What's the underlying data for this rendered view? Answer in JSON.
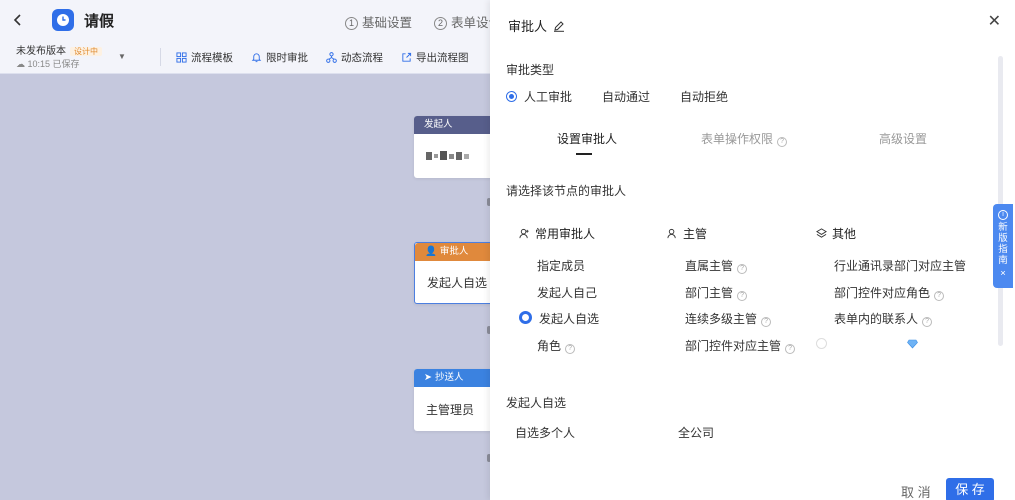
{
  "header": {
    "app_title": "请假",
    "steps": [
      {
        "num": "1",
        "label": "基础设置"
      },
      {
        "num": "2",
        "label": "表单设计"
      }
    ]
  },
  "toolbar": {
    "version_label": "未发布版本",
    "version_badge": "设计中",
    "saved_status": "10:15 已保存",
    "tools": [
      {
        "label": "流程模板",
        "icon": "grid-icon"
      },
      {
        "label": "限时审批",
        "icon": "bell-icon"
      },
      {
        "label": "动态流程",
        "icon": "flow-icon"
      },
      {
        "label": "导出流程图",
        "icon": "export-icon"
      }
    ]
  },
  "canvas": {
    "nodes": [
      {
        "header": "发起人",
        "body": "",
        "color": "#575e8b"
      },
      {
        "header": "审批人",
        "body": "发起人自选",
        "color": "#e0893c"
      },
      {
        "header": "抄送人",
        "body": "主管理员",
        "color": "#3b82e0"
      }
    ]
  },
  "panel": {
    "title": "审批人",
    "approval_type_label": "审批类型",
    "approval_types": [
      {
        "label": "人工审批",
        "selected": true
      },
      {
        "label": "自动通过",
        "selected": false
      },
      {
        "label": "自动拒绝",
        "selected": false
      }
    ],
    "tabs": [
      "设置审批人",
      "表单操作权限",
      "高级设置"
    ],
    "choose_label": "请选择该节点的审批人",
    "columns": [
      {
        "header": "常用审批人",
        "icon": "user-icon",
        "options": [
          {
            "label": "指定成员",
            "help": false,
            "selected": false
          },
          {
            "label": "发起人自己",
            "help": false,
            "selected": false
          },
          {
            "label": "发起人自选",
            "help": false,
            "selected": true
          },
          {
            "label": "角色",
            "help": true,
            "selected": false
          }
        ]
      },
      {
        "header": "主管",
        "icon": "user-icon",
        "options": [
          {
            "label": "直属主管",
            "help": true
          },
          {
            "label": "部门主管",
            "help": true
          },
          {
            "label": "连续多级主管",
            "help": true
          },
          {
            "label": "部门控件对应主管",
            "help": true
          }
        ]
      },
      {
        "header": "其他",
        "icon": "layers-icon",
        "options": [
          {
            "label": "行业通讯录部门对应主管",
            "help": false
          },
          {
            "label": "部门控件对应角色",
            "help": true
          },
          {
            "label": "表单内的联系人",
            "help": true
          },
          {
            "label": "",
            "help": false
          }
        ]
      }
    ],
    "self_select_label": "发起人自选",
    "self_select_mode": "自选多个人",
    "self_select_scope": "全公司",
    "cancel_label": "取 消",
    "save_label": "保 存"
  },
  "side_tab": {
    "label": "新版指南",
    "close": "×"
  },
  "colors": {
    "primary": "#2f6ee8",
    "canvas_bg": "#c5c8dd"
  }
}
